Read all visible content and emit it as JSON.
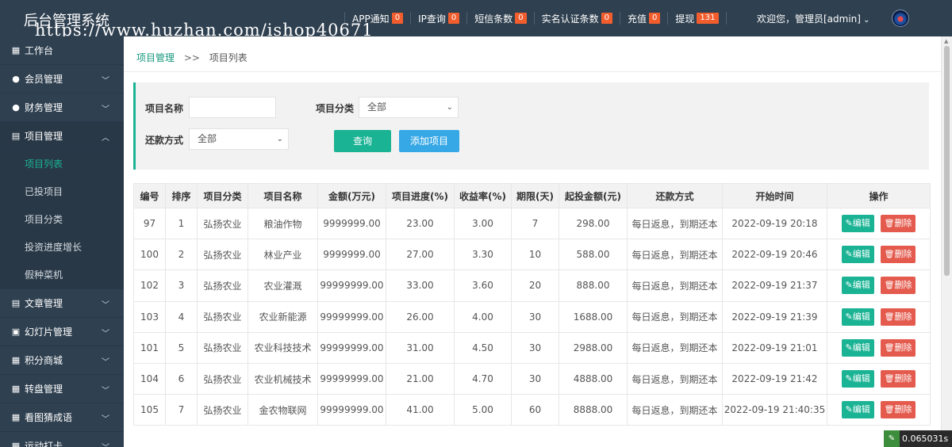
{
  "app": {
    "title": "后台管理系统",
    "watermark": "https://www.huzhan.com/ishop40671"
  },
  "topnav": [
    {
      "label": "APP通知",
      "count": "0"
    },
    {
      "label": "IP查询",
      "count": "0"
    },
    {
      "label": "短信条数",
      "count": "0"
    },
    {
      "label": "实名认证条数",
      "count": "0"
    },
    {
      "label": "充值",
      "count": "0"
    },
    {
      "label": "提现",
      "count": "131"
    }
  ],
  "user": {
    "welcome": "欢迎您，管理员[admin]"
  },
  "sidebar": {
    "items": [
      {
        "label": "工作台",
        "icon": "dashboard-icon"
      },
      {
        "label": "会员管理",
        "icon": "member-icon"
      },
      {
        "label": "财务管理",
        "icon": "finance-icon"
      },
      {
        "label": "项目管理",
        "icon": "project-icon"
      },
      {
        "label": "文章管理",
        "icon": "article-icon"
      },
      {
        "label": "幻灯片管理",
        "icon": "slide-icon"
      },
      {
        "label": "积分商城",
        "icon": "points-icon"
      },
      {
        "label": "转盘管理",
        "icon": "wheel-icon"
      },
      {
        "label": "看图猜成语",
        "icon": "idiom-icon"
      },
      {
        "label": "运动打卡",
        "icon": "sport-icon"
      }
    ],
    "project_sub": [
      {
        "label": "项目列表"
      },
      {
        "label": "已投项目"
      },
      {
        "label": "项目分类"
      },
      {
        "label": "投资进度增长"
      },
      {
        "label": "假种菜机"
      }
    ]
  },
  "breadcrumb": {
    "parent": "项目管理",
    "separator": ">>",
    "current": "项目列表"
  },
  "filters": {
    "name_label": "项目名称",
    "name_value": "",
    "category_label": "项目分类",
    "category_value": "全部",
    "repay_label": "还款方式",
    "repay_value": "全部",
    "query_button": "查询",
    "add_button": "添加项目"
  },
  "table": {
    "headers": [
      "编号",
      "排序",
      "项目分类",
      "项目名称",
      "金额(万元)",
      "项目进度(%)",
      "收益率(%)",
      "期限(天)",
      "起投金额(元)",
      "还款方式",
      "开始时间",
      "操作"
    ],
    "edit_label": "编辑",
    "delete_label": "删除",
    "rows": [
      [
        "97",
        "1",
        "弘扬农业",
        "粮油作物",
        "9999999.00",
        "23.00",
        "3.00",
        "7",
        "298.00",
        "每日返息，到期还本",
        "2022-09-19 20:18"
      ],
      [
        "100",
        "2",
        "弘扬农业",
        "林业产业",
        "9999999.00",
        "27.00",
        "3.30",
        "10",
        "588.00",
        "每日返息，到期还本",
        "2022-09-19 20:46"
      ],
      [
        "102",
        "3",
        "弘扬农业",
        "农业灌溉",
        "99999999.00",
        "33.00",
        "3.60",
        "20",
        "888.00",
        "每日返息，到期还本",
        "2022-09-19 21:37"
      ],
      [
        "103",
        "4",
        "弘扬农业",
        "农业新能源",
        "99999999.00",
        "26.00",
        "4.00",
        "30",
        "1688.00",
        "每日返息，到期还本",
        "2022-09-19 21:39"
      ],
      [
        "101",
        "5",
        "弘扬农业",
        "农业科技技术",
        "99999999.00",
        "31.00",
        "4.50",
        "30",
        "2988.00",
        "每日返息，到期还本",
        "2022-09-19 21:01"
      ],
      [
        "104",
        "6",
        "弘扬农业",
        "农业机械技术",
        "99999999.00",
        "21.00",
        "4.70",
        "30",
        "4888.00",
        "每日返息，到期还本",
        "2022-09-19 21:42"
      ],
      [
        "105",
        "7",
        "弘扬农业",
        "金农物联网",
        "99999999.00",
        "41.00",
        "5.00",
        "60",
        "8888.00",
        "每日返息，到期还本",
        "2022-09-19 21:40:35"
      ]
    ]
  },
  "timer": "0.065031s",
  "colors": {
    "sidebar": "#2f4050",
    "accent": "#1ab394",
    "badge": "#f25d2d",
    "add": "#37a8e6",
    "delete": "#e45b4e"
  }
}
